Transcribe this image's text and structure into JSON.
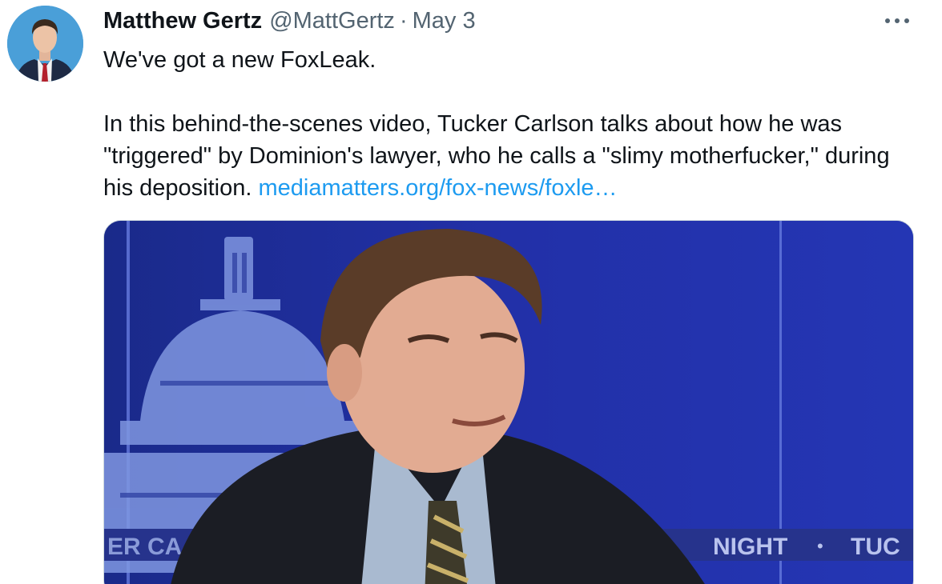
{
  "tweet": {
    "author": {
      "display_name": "Matthew Gertz",
      "handle": "@MattGertz"
    },
    "separator": "·",
    "date": "May 3",
    "more_icon": "more-horizontal-icon",
    "text_line1": "We've got a new FoxLeak.",
    "text_line2": "In this behind-the-scenes video, Tucker Carlson talks about how he was \"triggered\" by Dominion's lawyer, who he calls a \"slimy motherfucker,\" during his deposition.",
    "link_text": "mediamatters.org/fox-news/foxle…",
    "media": {
      "ticker_left": "ER CA",
      "ticker_right": "NIGHT",
      "ticker_sep": "•",
      "ticker_right2": "TUC"
    }
  },
  "colors": {
    "link": "#1d9bf0",
    "secondary_text": "#536471",
    "primary_text": "#0f1419"
  }
}
